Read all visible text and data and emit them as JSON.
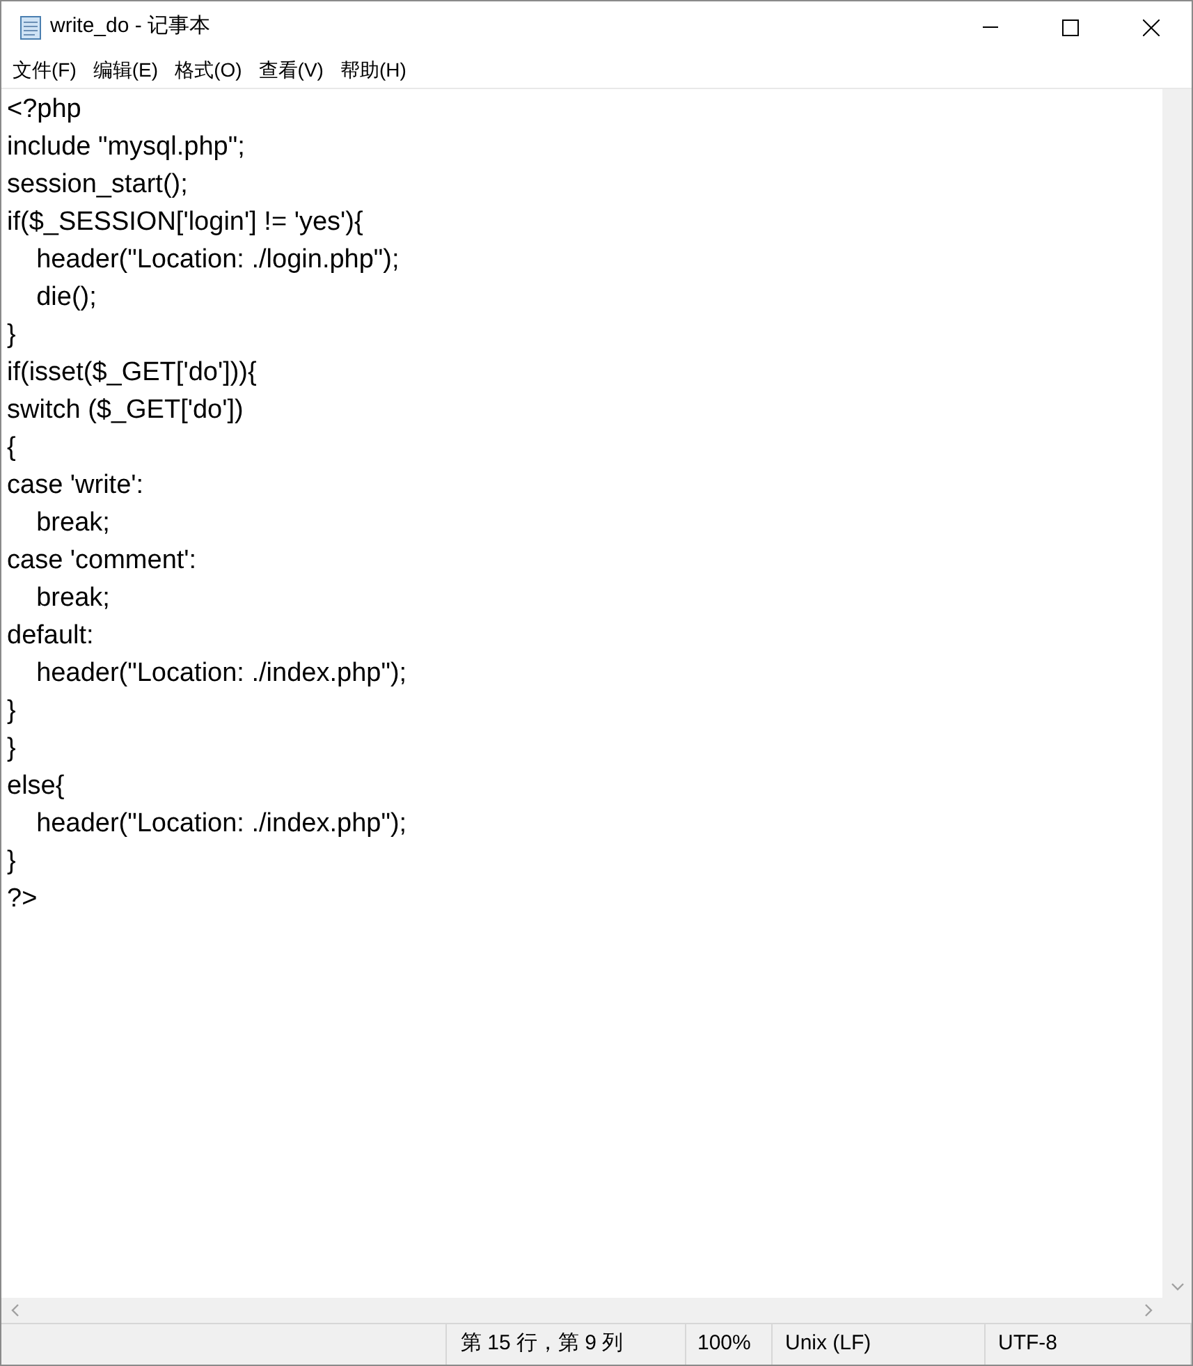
{
  "window": {
    "title": "write_do - 记事本"
  },
  "menu": [
    "文件(F)",
    "编辑(E)",
    "格式(O)",
    "查看(V)",
    "帮助(H)"
  ],
  "editor": {
    "lines": [
      "<?php",
      "include \"mysql.php\";",
      "session_start();",
      "if($_SESSION['login'] != 'yes'){",
      "    header(\"Location: ./login.php\");",
      "    die();",
      "}",
      "if(isset($_GET['do'])){",
      "switch ($_GET['do'])",
      "{",
      "case 'write':",
      "    break;",
      "case 'comment':",
      "    break;",
      "default:",
      "    header(\"Location: ./index.php\");",
      "}",
      "}",
      "else{",
      "    header(\"Location: ./index.php\");",
      "}",
      "?>"
    ]
  },
  "status_bar": [
    "第 15 行，第 9 列",
    "100%",
    "Unix (LF)",
    "UTF-8"
  ]
}
